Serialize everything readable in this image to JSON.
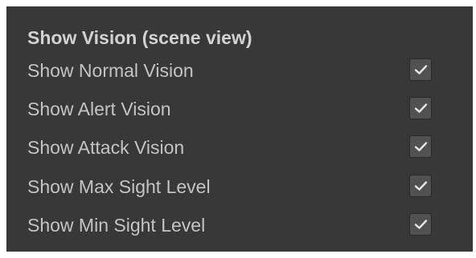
{
  "section": {
    "title": "Show Vision (scene view)"
  },
  "options": [
    {
      "label": "Show Normal Vision",
      "checked": true,
      "icon": "checkmark-icon"
    },
    {
      "label": "Show Alert Vision",
      "checked": true,
      "icon": "checkmark-icon"
    },
    {
      "label": "Show Attack Vision",
      "checked": true,
      "icon": "checkmark-icon"
    },
    {
      "label": "Show Max Sight Level",
      "checked": true,
      "icon": "checkmark-icon"
    },
    {
      "label": "Show Min Sight Level",
      "checked": true,
      "icon": "checkmark-icon"
    }
  ],
  "colors": {
    "panel_background": "#383838",
    "checkbox_background": "#515151",
    "checkmark": "#e6e6e6"
  }
}
